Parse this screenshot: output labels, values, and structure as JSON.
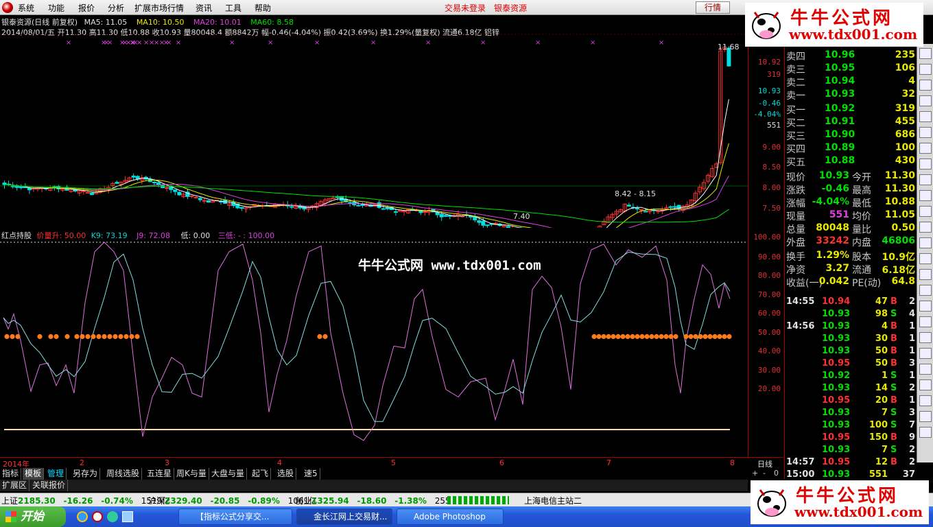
{
  "menu": {
    "items": [
      "系统",
      "功能",
      "报价",
      "分析",
      "扩展市场行情",
      "资讯",
      "工具",
      "帮助"
    ],
    "trade_status": "交易未登录",
    "stock_name_top": "银泰资源",
    "btn_quote": "行情"
  },
  "main_chart": {
    "title": "银泰资源(日线 前复权)",
    "ma5": "MA5: 11.05",
    "ma10": "MA10: 10.50",
    "ma20": "MA20: 10.01",
    "ma60": "MA60: 8.58",
    "ohlc_line": "2014/08/01/五 开11.30 高11.30 低10.88 收10.93 量80048.4 额8842万 幅-0.46(-4.04%) 振0.42(3.69%) 换1.29%(量复权) 流通6.18亿 铝锌",
    "high_label": "11.68",
    "low_label": "7.40",
    "mid_label": "8.42 - 8.15",
    "axis": [
      "10.93",
      "32",
      "10.92",
      "319",
      "10.93",
      "-0.46",
      "-4.04%",
      "551",
      "9.00",
      "8.50",
      "8.00",
      "7.50"
    ]
  },
  "indicator": {
    "name": "红点持股",
    "p1": "价量升: 50.00",
    "p2": "K9: 73.19",
    "p3": "J9: 72.08",
    "p4": "低: 0.00",
    "p5": "三低: - : 100.00",
    "axis": [
      "100.00",
      "90.00",
      "80.00",
      "70.00",
      "60.00",
      "50.00",
      "40.00",
      "30.00",
      "20.00"
    ]
  },
  "x_axis": {
    "labels": [
      "2014年",
      "2",
      "3",
      "4",
      "5",
      "6",
      "7",
      "8"
    ],
    "period": "日线"
  },
  "center_watermark": "牛牛公式网 www.tdx001.com",
  "watermark": {
    "title": "牛牛公式网",
    "url": "www.tdx001.com"
  },
  "quote": {
    "sell": [
      {
        "label": "卖四",
        "price": "10.96",
        "vol": "235"
      },
      {
        "label": "卖三",
        "price": "10.95",
        "vol": "106"
      },
      {
        "label": "卖二",
        "price": "10.94",
        "vol": "4"
      },
      {
        "label": "卖一",
        "price": "10.93",
        "vol": "32"
      }
    ],
    "buy": [
      {
        "label": "买一",
        "price": "10.92",
        "vol": "319"
      },
      {
        "label": "买二",
        "price": "10.91",
        "vol": "455"
      },
      {
        "label": "买三",
        "price": "10.90",
        "vol": "686"
      },
      {
        "label": "买四",
        "price": "10.89",
        "vol": "100"
      },
      {
        "label": "买五",
        "price": "10.88",
        "vol": "430"
      }
    ],
    "stats": [
      {
        "l1": "现价",
        "v1": "10.93",
        "l2": "今开",
        "v2": "11.30"
      },
      {
        "l1": "涨跌",
        "v1": "-0.46",
        "l2": "最高",
        "v2": "11.30"
      },
      {
        "l1": "涨幅",
        "v1": "-4.04%",
        "l2": "最低",
        "v2": "10.88"
      },
      {
        "l1": "现量",
        "v1": "551",
        "l2": "均价",
        "v2": "11.05"
      },
      {
        "l1": "总量",
        "v1": "80048",
        "l2": "量比",
        "v2": "0.50"
      },
      {
        "l1": "外盘",
        "v1": "33242",
        "l2": "内盘",
        "v2": "46806"
      }
    ],
    "fund": [
      {
        "l1": "换手",
        "v1": "1.29%",
        "l2": "股本",
        "v2": "10.9亿"
      },
      {
        "l1": "净资",
        "v1": "3.27",
        "l2": "流通",
        "v2": "6.18亿"
      },
      {
        "l1": "收益(一)",
        "v1": "0.042",
        "l2": "PE(动)",
        "v2": "64.8"
      }
    ],
    "ticks": [
      {
        "time": "14:55",
        "price": "10.94",
        "vol": "47",
        "bs": "B",
        "n": "2"
      },
      {
        "time": "",
        "price": "10.93",
        "vol": "98",
        "bs": "S",
        "n": "4"
      },
      {
        "time": "14:56",
        "price": "10.93",
        "vol": "4",
        "bs": "B",
        "n": "1"
      },
      {
        "time": "",
        "price": "10.93",
        "vol": "30",
        "bs": "B",
        "n": "1"
      },
      {
        "time": "",
        "price": "10.93",
        "vol": "50",
        "bs": "B",
        "n": "1"
      },
      {
        "time": "",
        "price": "10.95",
        "vol": "50",
        "bs": "B",
        "n": "3"
      },
      {
        "time": "",
        "price": "10.92",
        "vol": "1",
        "bs": "S",
        "n": "1"
      },
      {
        "time": "",
        "price": "10.93",
        "vol": "14",
        "bs": "S",
        "n": "2"
      },
      {
        "time": "",
        "price": "10.95",
        "vol": "20",
        "bs": "B",
        "n": "1"
      },
      {
        "time": "",
        "price": "10.93",
        "vol": "7",
        "bs": "S",
        "n": "3"
      },
      {
        "time": "",
        "price": "10.93",
        "vol": "100",
        "bs": "S",
        "n": "7"
      },
      {
        "time": "",
        "price": "10.95",
        "vol": "150",
        "bs": "B",
        "n": "9"
      },
      {
        "time": "",
        "price": "10.93",
        "vol": "7",
        "bs": "S",
        "n": "2"
      },
      {
        "time": "14:57",
        "price": "10.95",
        "vol": "12",
        "bs": "B",
        "n": "2"
      },
      {
        "time": "15:00",
        "price": "10.93",
        "vol": "551",
        "bs": "",
        "n": "37"
      }
    ]
  },
  "tabs": [
    "指标",
    "模板",
    "管理",
    "另存为",
    "周线选股",
    "五连星",
    "周K与量",
    "大盘与量",
    "起飞",
    "选股",
    "速5"
  ],
  "ex_tabs": [
    "扩展区",
    "关联报价"
  ],
  "index_bar": {
    "sh_label": "上证",
    "sh_val": "2185.30",
    "sh_chg": "-16.26",
    "sh_pct": "-0.74%",
    "sh_amt": "1519亿",
    "sz_label": "沪深",
    "sz_val": "2329.40",
    "sz_chg": "-20.85",
    "sz_pct": "-0.89%",
    "sz_amt": "1061亿",
    "cy_label": "创业",
    "cy_val": "1325.94",
    "cy_chg": "-18.60",
    "cy_pct": "-1.38%",
    "cy_amt": "255.8亿",
    "server": "上海电信主站二"
  },
  "taskbar": {
    "start": "开始",
    "apps": [
      "【指标公式分享交...",
      "金长江网上交易财...",
      "Adobe Photoshop"
    ]
  },
  "colors": {
    "up": "#ff3030",
    "down": "#00e0e0",
    "ma5": "#ffffff",
    "ma10": "#e8e800",
    "ma20": "#e040e0",
    "ma60": "#00e000",
    "k": "#e070e0",
    "d": "#80e0e0",
    "dot": "#ff7a1a"
  }
}
